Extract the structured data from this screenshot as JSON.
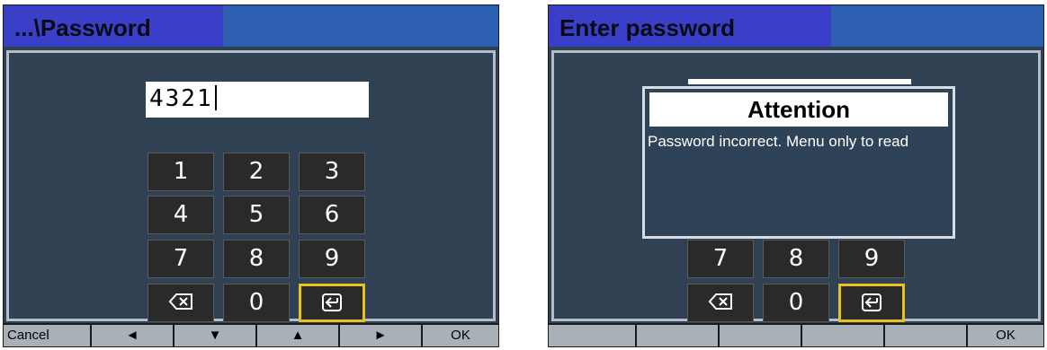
{
  "left": {
    "title": "...\\Password",
    "input_value": "4321",
    "keypad": [
      {
        "label": "1",
        "name": "key-1"
      },
      {
        "label": "2",
        "name": "key-2"
      },
      {
        "label": "3",
        "name": "key-3"
      },
      {
        "label": "4",
        "name": "key-4"
      },
      {
        "label": "5",
        "name": "key-5"
      },
      {
        "label": "6",
        "name": "key-6"
      },
      {
        "label": "7",
        "name": "key-7"
      },
      {
        "label": "8",
        "name": "key-8"
      },
      {
        "label": "9",
        "name": "key-9"
      },
      {
        "icon": "backspace-icon",
        "name": "key-backspace"
      },
      {
        "label": "0",
        "name": "key-0"
      },
      {
        "icon": "enter-icon",
        "name": "key-enter",
        "selected": true
      }
    ],
    "softkeys": [
      "Cancel",
      "◄",
      "▼",
      "▲",
      "►",
      "OK"
    ]
  },
  "right": {
    "title": "Enter password",
    "dialog": {
      "title": "Attention",
      "message": "Password incorrect. Menu only to read"
    },
    "keypad": [
      {
        "label": "7",
        "name": "key-7"
      },
      {
        "label": "8",
        "name": "key-8"
      },
      {
        "label": "9",
        "name": "key-9"
      },
      {
        "icon": "backspace-icon",
        "name": "key-backspace"
      },
      {
        "label": "0",
        "name": "key-0"
      },
      {
        "icon": "enter-icon",
        "name": "key-enter",
        "selected": true
      }
    ],
    "softkeys": [
      "",
      "",
      "",
      "",
      "",
      "OK"
    ]
  },
  "colors": {
    "screen_bg": "#2f4153",
    "titlebar": "#2d5fb0",
    "title_tab": "#3a3fc8",
    "selected_border": "#e8c21a",
    "softbar": "#a8b0b8"
  }
}
